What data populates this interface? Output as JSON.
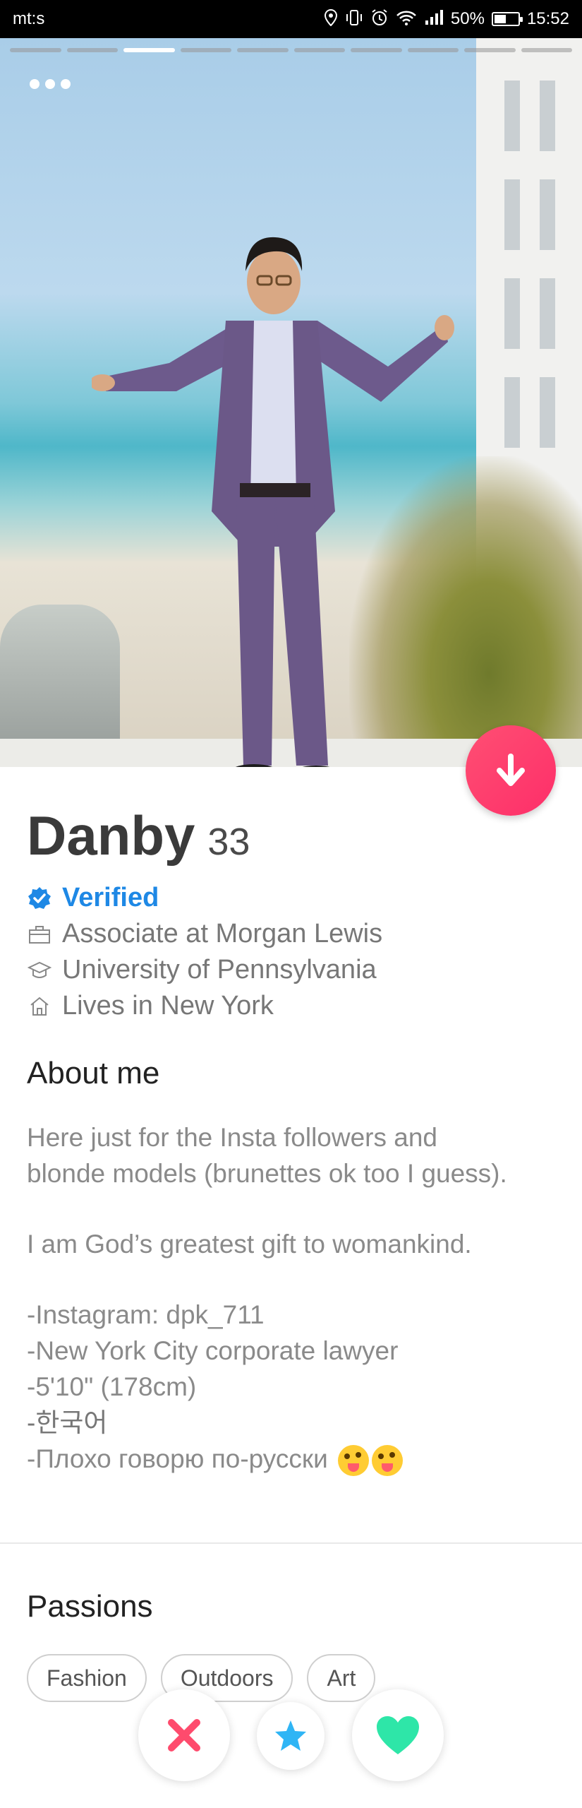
{
  "status_bar": {
    "carrier": "mt:s",
    "battery": "50%",
    "battery_level": 0.5,
    "time": "15:52",
    "icons": [
      "location-icon",
      "vibrate-icon",
      "alarm-icon",
      "wifi-icon",
      "signal-icon",
      "battery-icon"
    ]
  },
  "photo": {
    "segments_total": 10,
    "active_segment": 3
  },
  "profile": {
    "name": "Danby",
    "age": "33",
    "verified_label": "Verified",
    "job": "Associate at Morgan Lewis",
    "school": "University of Pennsylvania",
    "location": "Lives in New York"
  },
  "about": {
    "title": "About me",
    "line1": "Here just for the Insta followers and",
    "line2": "blonde models (brunettes ok too I guess).",
    "line3": "I am God’s greatest gift to womankind.",
    "line4": "-Instagram: dpk_711",
    "line5": "-New York City corporate lawyer",
    "line6": "-5'10\" (178cm)",
    "line7": "-한국어",
    "line8": "-Плохо говорю по-русски"
  },
  "passions": {
    "title": "Passions",
    "items": [
      "Fashion",
      "Outdoors",
      "Art"
    ]
  },
  "colors": {
    "accent": "#fd3a6b",
    "verified": "#1e88e5",
    "super_like": "#2fb5f5",
    "like": "#2ee6a8",
    "nope": "#fe4b6d"
  }
}
